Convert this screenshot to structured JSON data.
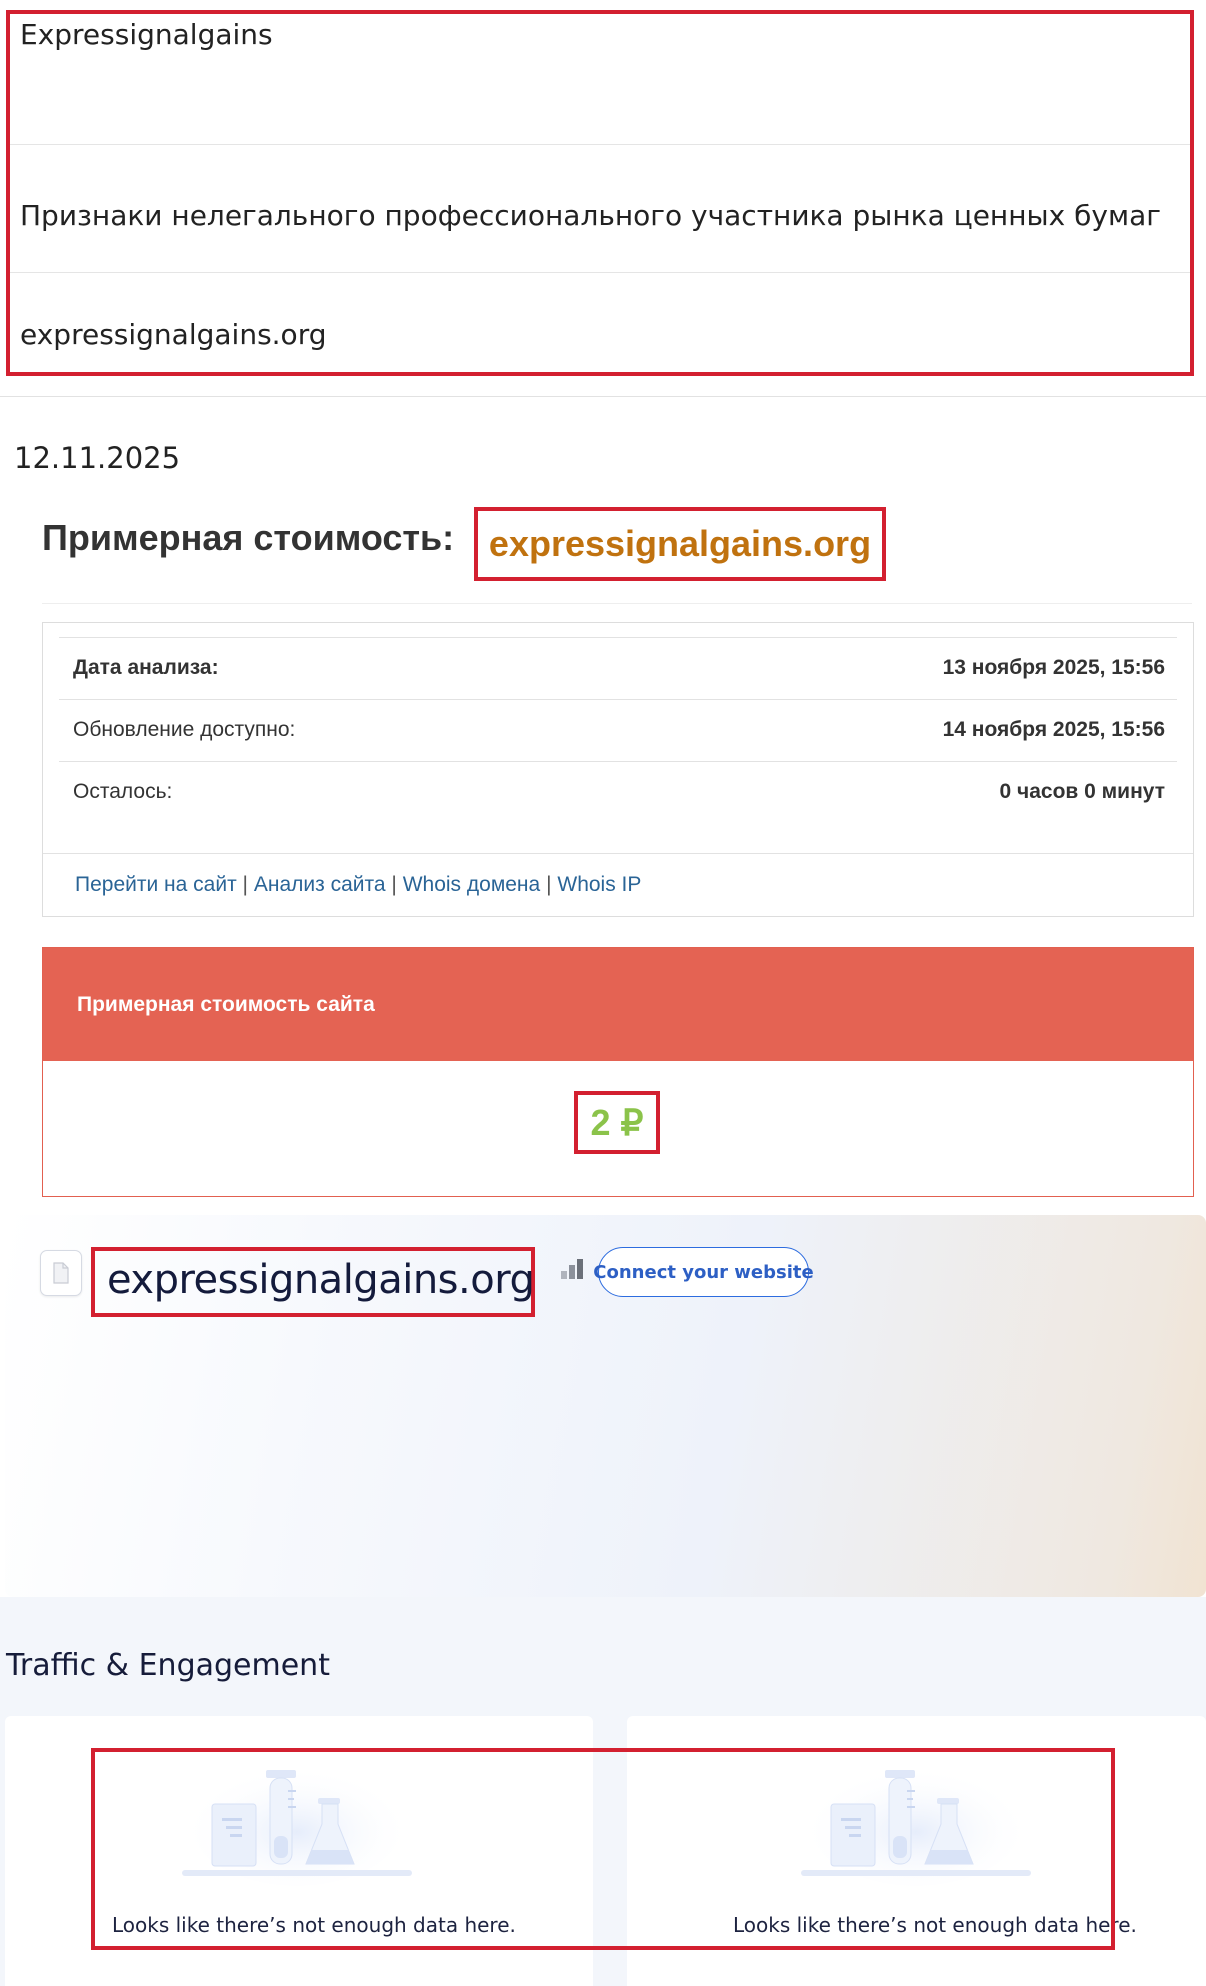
{
  "info_table": {
    "name": "Expressignalgains",
    "category": "Признаки нелегального профессионального участника рынка ценных бумаг",
    "domain": "expressignalgains.org"
  },
  "date": "12.11.2025",
  "estimate": {
    "heading": "Примерная стоимость:",
    "domain": "expressignalgains.org",
    "rows": [
      {
        "label": "Дата анализа:",
        "value": "13 ноября 2025, 15:56"
      },
      {
        "label": "Обновление доступно:",
        "value": "14 ноября 2025, 15:56"
      },
      {
        "label": "Осталось:",
        "value": "0 часов 0 минут"
      }
    ],
    "links": [
      "Перейти на сайт",
      "Анализ сайта",
      "Whois домена",
      "Whois IP"
    ],
    "link_separator": "|"
  },
  "cost_card": {
    "title": "Примерная стоимость сайта",
    "value": "2 ₽"
  },
  "site_card": {
    "domain": "expressignalgains.org",
    "connect_label": "Connect your website",
    "icons": [
      "file-icon",
      "rank-bars-icon"
    ]
  },
  "traffic": {
    "title": "Traffic & Engagement",
    "cards": [
      {
        "empty_message": "Looks like there’s not enough data here."
      },
      {
        "empty_message": "Looks like there’s not enough data here."
      }
    ]
  },
  "colors": {
    "highlight_border": "#d32030",
    "domain_accent": "#c0720f",
    "cost_header": "#e46353",
    "cost_value": "#8bc34a",
    "link": "#2a6496",
    "connect_button": "#2d6cdf"
  }
}
